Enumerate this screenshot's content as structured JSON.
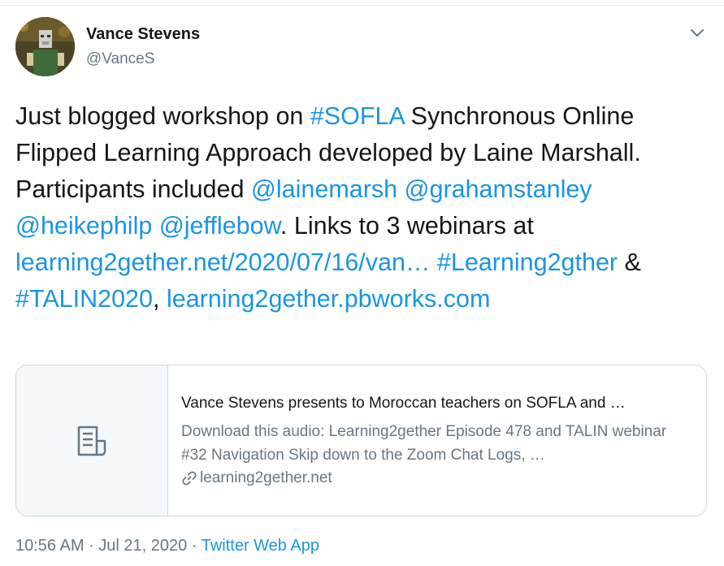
{
  "author": {
    "name": "Vance Stevens",
    "handle": "@VanceS"
  },
  "tweet": {
    "segments": [
      {
        "text": "Just blogged workshop on ",
        "link": false
      },
      {
        "text": "#SOFLA",
        "link": true
      },
      {
        "text": " Synchronous Online Flipped Learning Approach developed by Laine Marshall. Participants included ",
        "link": false
      },
      {
        "text": "@lainemarsh",
        "link": true
      },
      {
        "text": " ",
        "link": false
      },
      {
        "text": "@grahamstanley",
        "link": true
      },
      {
        "text": " ",
        "link": false
      },
      {
        "text": "@heikephilp",
        "link": true
      },
      {
        "text": " ",
        "link": false
      },
      {
        "text": "@jefflebow",
        "link": true
      },
      {
        "text": ". Links to 3 webinars at ",
        "link": false
      },
      {
        "text": "learning2gether.net/2020/07/16/van…",
        "link": true
      },
      {
        "text": " ",
        "link": false
      },
      {
        "text": "#Learning2gther",
        "link": true
      },
      {
        "text": " & ",
        "link": false
      },
      {
        "text": "#TALIN2020",
        "link": true
      },
      {
        "text": ", ",
        "link": false
      },
      {
        "text": "learning2gether.pbworks.com",
        "link": true
      }
    ]
  },
  "card": {
    "title": "Vance Stevens presents to Moroccan teachers on SOFLA and …",
    "description": "Download this audio: Learning2gether Episode 478 and TALIN webinar #32 Navigation Skip down to the Zoom Chat Logs, …",
    "domain": "learning2gether.net",
    "thumb_icon": "document-icon",
    "domain_icon": "link-icon"
  },
  "meta": {
    "time": "10:56 AM",
    "sep1": " · ",
    "date": "Jul 21, 2020",
    "sep2": " · ",
    "app": "Twitter Web App"
  },
  "icons": {
    "menu": "chevron-down-icon"
  },
  "colors": {
    "link": "#1b95e0",
    "secondary": "#657786",
    "border": "#ccd6dd"
  }
}
